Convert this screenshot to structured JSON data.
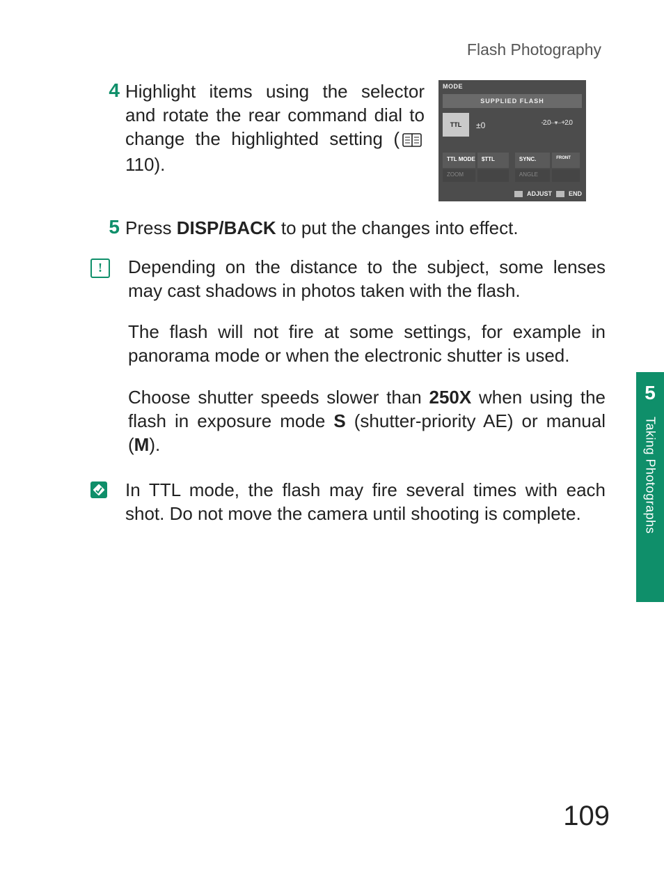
{
  "header": "Flash Photography",
  "steps": {
    "s4": {
      "num": "4",
      "text_before": "Highlight items using the se­lector and rotate the rear com­mand dial to change the high­lighted setting (",
      "page_ref": " 110).",
      "screenshot": {
        "mode": "MODE",
        "supplied": "SUPPLIED FLASH",
        "ttl": "TTL",
        "val": "±0",
        "scale_left": "-2.0",
        "scale_right": "+2.0",
        "ttl_mode": "TTL MODE",
        "ttl_val": "$TTL",
        "sync": "SYNC.",
        "sync_val": "FRONT",
        "zoom": "ZOOM",
        "angle": "ANGLE",
        "adjust": "ADJUST",
        "end": "END"
      }
    },
    "s5": {
      "num": "5",
      "prefix": "Press ",
      "bold": "DISP/BACK",
      "suffix": " to put the changes into effect."
    }
  },
  "caution": {
    "p1": "Depending on the distance to the subject, some lenses may cast shadows in photos taken with the flash.",
    "p2": "The flash will not fire at some settings, for example in panorama mode or when the electronic shutter is used.",
    "p3_a": "Choose shutter speeds slower than ",
    "p3_b1": "250X",
    "p3_c": " when using the flash in exposure mode ",
    "p3_b2": "S",
    "p3_d": " (shutter-priority AE) or manual (",
    "p3_b3": "M",
    "p3_e": ")."
  },
  "tip": {
    "p1": "In TTL mode, the flash may fire several times with each shot. Do not move the camera until shooting is com­plete."
  },
  "sidetab": {
    "num": "5",
    "label": "Taking Photographs"
  },
  "page_number": "109"
}
